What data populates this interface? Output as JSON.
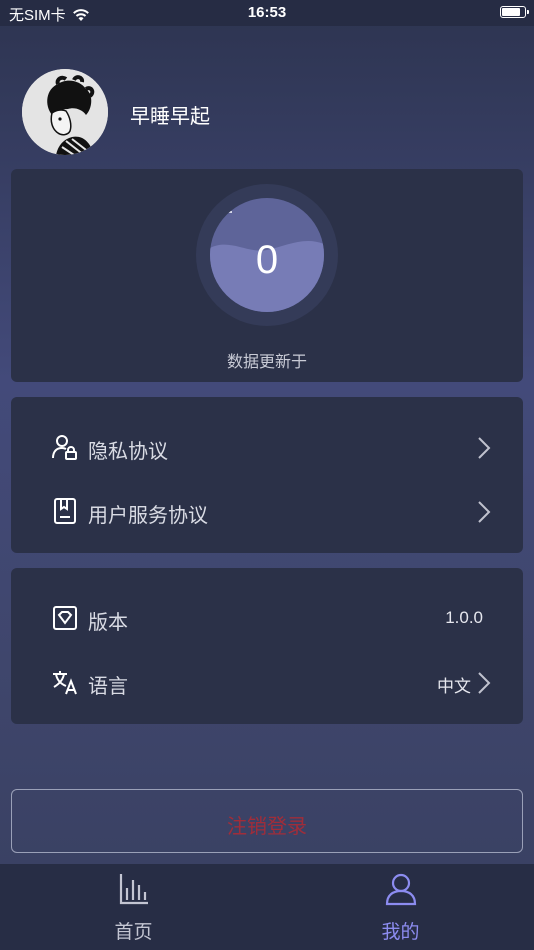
{
  "status_bar": {
    "carrier": "无SIM卡",
    "time": "16:53"
  },
  "profile": {
    "username": "早睡早起"
  },
  "sleep_card": {
    "value": "0",
    "update_text": "数据更新于"
  },
  "links": [
    {
      "label": "隐私协议",
      "icon": "user-lock-icon"
    },
    {
      "label": "用户服务协议",
      "icon": "document-icon"
    }
  ],
  "info": [
    {
      "label": "版本",
      "value": "1.0.0",
      "icon": "version-icon"
    },
    {
      "label": "语言",
      "value": "中文",
      "icon": "translate-icon"
    }
  ],
  "logout": {
    "label": "注销登录",
    "color": "#a02d3a"
  },
  "tabs": [
    {
      "label": "首页",
      "icon": "bar-chart-icon",
      "color": "#c3c5d2",
      "active": false
    },
    {
      "label": "我的",
      "icon": "person-icon",
      "color": "#8c8cf0",
      "active": true
    }
  ]
}
